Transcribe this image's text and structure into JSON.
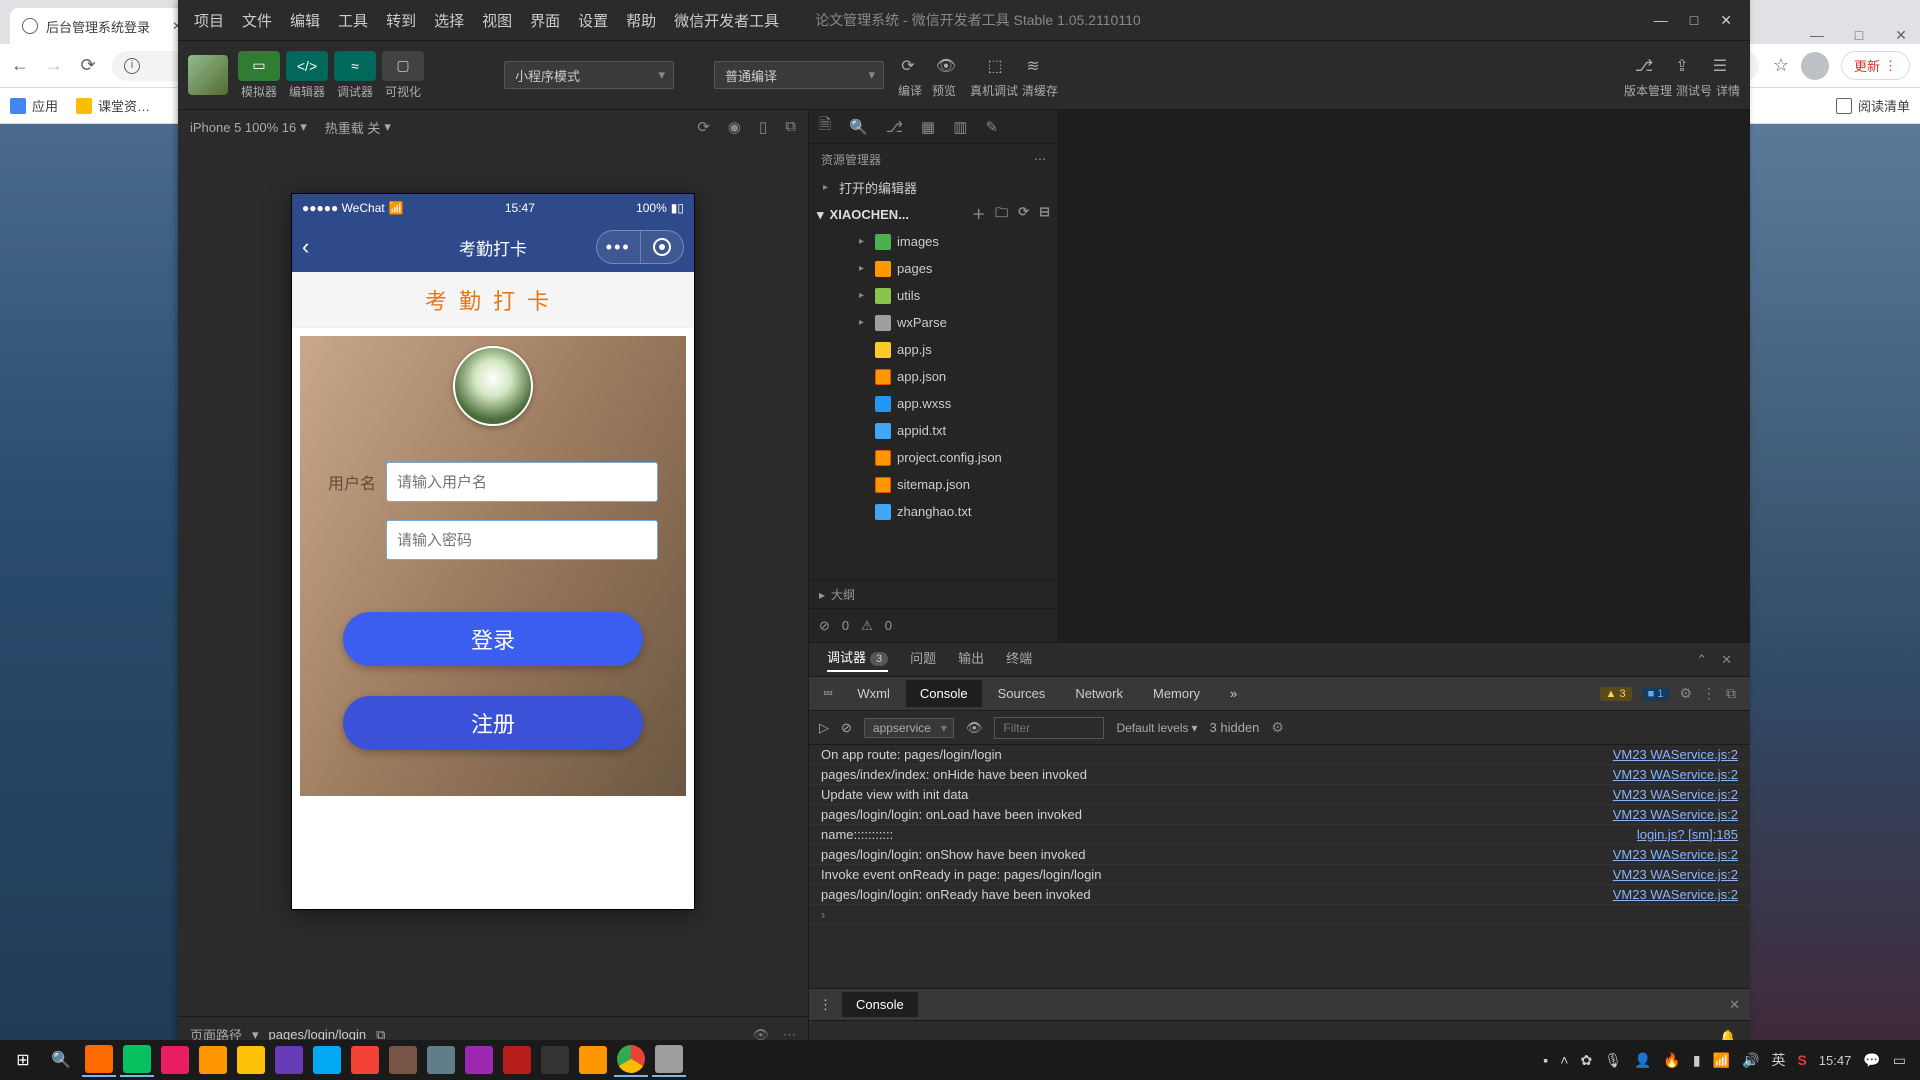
{
  "browser": {
    "tab_title": "后台管理系统登录",
    "win_min": "—",
    "win_max": "□",
    "win_close": "✕",
    "update_label": "更新",
    "bookmarks": {
      "apps": "应用",
      "folder": "课堂资…",
      "readlist": "阅读清单"
    }
  },
  "devtools": {
    "menus": [
      "项目",
      "文件",
      "编辑",
      "工具",
      "转到",
      "选择",
      "视图",
      "界面",
      "设置",
      "帮助",
      "微信开发者工具"
    ],
    "title": "论文管理系统 - 微信开发者工具 Stable 1.05.2110110",
    "modes": {
      "sim": "模拟器",
      "edit": "编辑器",
      "debug": "调试器",
      "vis": "可视化"
    },
    "compile_mode": "小程序模式",
    "compile_target": "普通编译",
    "actions": {
      "compile": "编译",
      "preview": "预览",
      "remote": "真机调试",
      "clear": "清缓存"
    },
    "right_actions": {
      "version": "版本管理",
      "test": "测试号",
      "detail": "详情"
    }
  },
  "sim": {
    "device": "iPhone 5 100% 16",
    "hotreload": "热重载 关",
    "status_left": "●●●●● WeChat",
    "status_wifi": "⋮",
    "status_time": "15:47",
    "status_pct": "100%",
    "nav_title": "考勤打卡",
    "banner": "考勤打卡",
    "username_label": "用户名",
    "username_ph": "请输入用户名",
    "password_ph": "请输入密码",
    "login_btn": "登录",
    "register_btn": "注册",
    "footer_label": "页面路径",
    "footer_path": "pages/login/login"
  },
  "explorer": {
    "title": "资源管理器",
    "open_editors": "打开的编辑器",
    "project": "XIAOCHEN...",
    "tree": [
      {
        "label": "images",
        "cls": "folder-img"
      },
      {
        "label": "pages",
        "cls": "folder-pg"
      },
      {
        "label": "utils",
        "cls": "folder-ut"
      },
      {
        "label": "wxParse",
        "cls": "folder-wx"
      },
      {
        "label": "app.js",
        "cls": "js"
      },
      {
        "label": "app.json",
        "cls": "json"
      },
      {
        "label": "app.wxss",
        "cls": "wxss"
      },
      {
        "label": "appid.txt",
        "cls": "txt"
      },
      {
        "label": "project.config.json",
        "cls": "json"
      },
      {
        "label": "sitemap.json",
        "cls": "json"
      },
      {
        "label": "zhanghao.txt",
        "cls": "txt"
      }
    ],
    "outline": "大纲",
    "status_err": "0",
    "status_warn": "0"
  },
  "console": {
    "tabs": {
      "debug": "调试器",
      "debug_badge": "3",
      "issues": "问题",
      "output": "输出",
      "terminal": "终端"
    },
    "devtabs": [
      "Wxml",
      "Console",
      "Sources",
      "Network",
      "Memory"
    ],
    "warn_count": "3",
    "info_count": "1",
    "context": "appservice",
    "filter_ph": "Filter",
    "levels": "Default levels",
    "hidden": "3 hidden",
    "logs": [
      {
        "msg": "On app route: pages/login/login",
        "src": "VM23 WAService.js:2"
      },
      {
        "msg": "pages/index/index: onHide have been invoked",
        "src": "VM23 WAService.js:2"
      },
      {
        "msg": "Update view with init data",
        "src": "VM23 WAService.js:2"
      },
      {
        "msg": "pages/login/login: onLoad have been invoked",
        "src": "VM23 WAService.js:2"
      },
      {
        "msg": "name:::::::::::",
        "src": "login.js? [sm]:185"
      },
      {
        "msg": "pages/login/login: onShow have been invoked",
        "src": "VM23 WAService.js:2"
      },
      {
        "msg": "Invoke event onReady in page: pages/login/login",
        "src": "VM23 WAService.js:2"
      },
      {
        "msg": "pages/login/login: onReady have been invoked",
        "src": "VM23 WAService.js:2"
      }
    ],
    "drawer_tab": "Console"
  },
  "taskbar": {
    "clock": "15:47",
    "ime": "英"
  }
}
